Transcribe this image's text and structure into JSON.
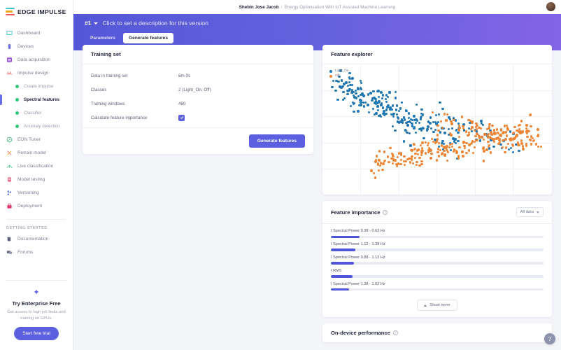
{
  "brand": {
    "name": "EDGE IMPULSE"
  },
  "topbar": {
    "user": "Shebin Jose Jacob",
    "separator": "/",
    "project": "Energy Optimisation With IoT Assisted Machine Learning",
    "avatar_name": "avatar"
  },
  "sidebar": {
    "items": [
      {
        "label": "Dashboard",
        "icon": "dashboard-icon"
      },
      {
        "label": "Devices",
        "icon": "devices-icon"
      },
      {
        "label": "Data acquisition",
        "icon": "data-acquisition-icon"
      },
      {
        "label": "Impulse design",
        "icon": "impulse-design-icon"
      }
    ],
    "sub_items": [
      {
        "label": "Create impulse",
        "active": false
      },
      {
        "label": "Spectral features",
        "active": true
      },
      {
        "label": "Classifier",
        "active": false
      },
      {
        "label": "Anomaly detection",
        "active": false
      }
    ],
    "items2": [
      {
        "label": "EON Tuner",
        "icon": "eon-tuner-icon"
      },
      {
        "label": "Retrain model",
        "icon": "retrain-model-icon"
      },
      {
        "label": "Live classification",
        "icon": "live-classification-icon"
      },
      {
        "label": "Model testing",
        "icon": "model-testing-icon"
      },
      {
        "label": "Versioning",
        "icon": "versioning-icon"
      },
      {
        "label": "Deployment",
        "icon": "deployment-icon"
      }
    ],
    "section_label": "GETTING STARTED",
    "items3": [
      {
        "label": "Documentation",
        "icon": "documentation-icon"
      },
      {
        "label": "Forums",
        "icon": "forums-icon"
      }
    ],
    "promo": {
      "title": "Try Enterprise Free",
      "subtitle": "Get access to high job limits and training on GPUs.",
      "button": "Start free trial"
    }
  },
  "header": {
    "version_id": "#1",
    "description_placeholder": "Click to set a description for this version",
    "tabs": [
      {
        "label": "Parameters",
        "active": false
      },
      {
        "label": "Generate features",
        "active": true
      }
    ]
  },
  "training_set": {
    "title": "Training set",
    "rows": [
      {
        "label": "Data in training set",
        "value": "8m 0s"
      },
      {
        "label": "Classes",
        "value": "2 (Light_On, Off)"
      },
      {
        "label": "Training windows",
        "value": "480"
      }
    ],
    "checkbox_label": "Calculate feature importance",
    "checkbox_checked": true,
    "generate_button": "Generate features"
  },
  "feature_explorer": {
    "title": "Feature explorer",
    "legend": [
      {
        "label": "Light_On",
        "color": "#1f77b4"
      },
      {
        "label": "Off",
        "color": "#ef8636"
      }
    ]
  },
  "feature_importance": {
    "title": "Feature importance",
    "help_icon": "question-mark-icon",
    "filter_value": "All data",
    "show_more": "Show more",
    "items": [
      {
        "label": "I Spectral Power 0.38 - 0.62 Hz",
        "value": 13.5
      },
      {
        "label": "I Spectral Power 1.12 - 1.38 Hz",
        "value": 11.5
      },
      {
        "label": "I Spectral Power 0.88 - 1.12 Hz",
        "value": 11.0
      },
      {
        "label": "I RMS",
        "value": 10.2
      },
      {
        "label": "I Spectral Power 1.38 - 1.62 Hz",
        "value": 8.6
      }
    ]
  },
  "on_device_performance": {
    "title": "On-device performance",
    "help_icon": "question-mark-icon"
  },
  "help_fab": {
    "label": "?"
  },
  "colors": {
    "accent": "#5b5fe0",
    "header_gradient_from": "#5457d6",
    "header_gradient_to": "#8364e6",
    "series_light_on": "#1f77b4",
    "series_off": "#ef8636",
    "bar_fill": "#4f57d8"
  },
  "chart_data": {
    "type": "scatter",
    "title": "Feature explorer",
    "series": [
      {
        "name": "Light_On",
        "color": "#1f77b4"
      },
      {
        "name": "Off",
        "color": "#ef8636"
      }
    ],
    "xlabel": "",
    "ylabel": "",
    "grid": true,
    "legend_position": "top-left",
    "note": "t-SNE style 2D projection of 480 training windows, two overlapping clusters"
  }
}
